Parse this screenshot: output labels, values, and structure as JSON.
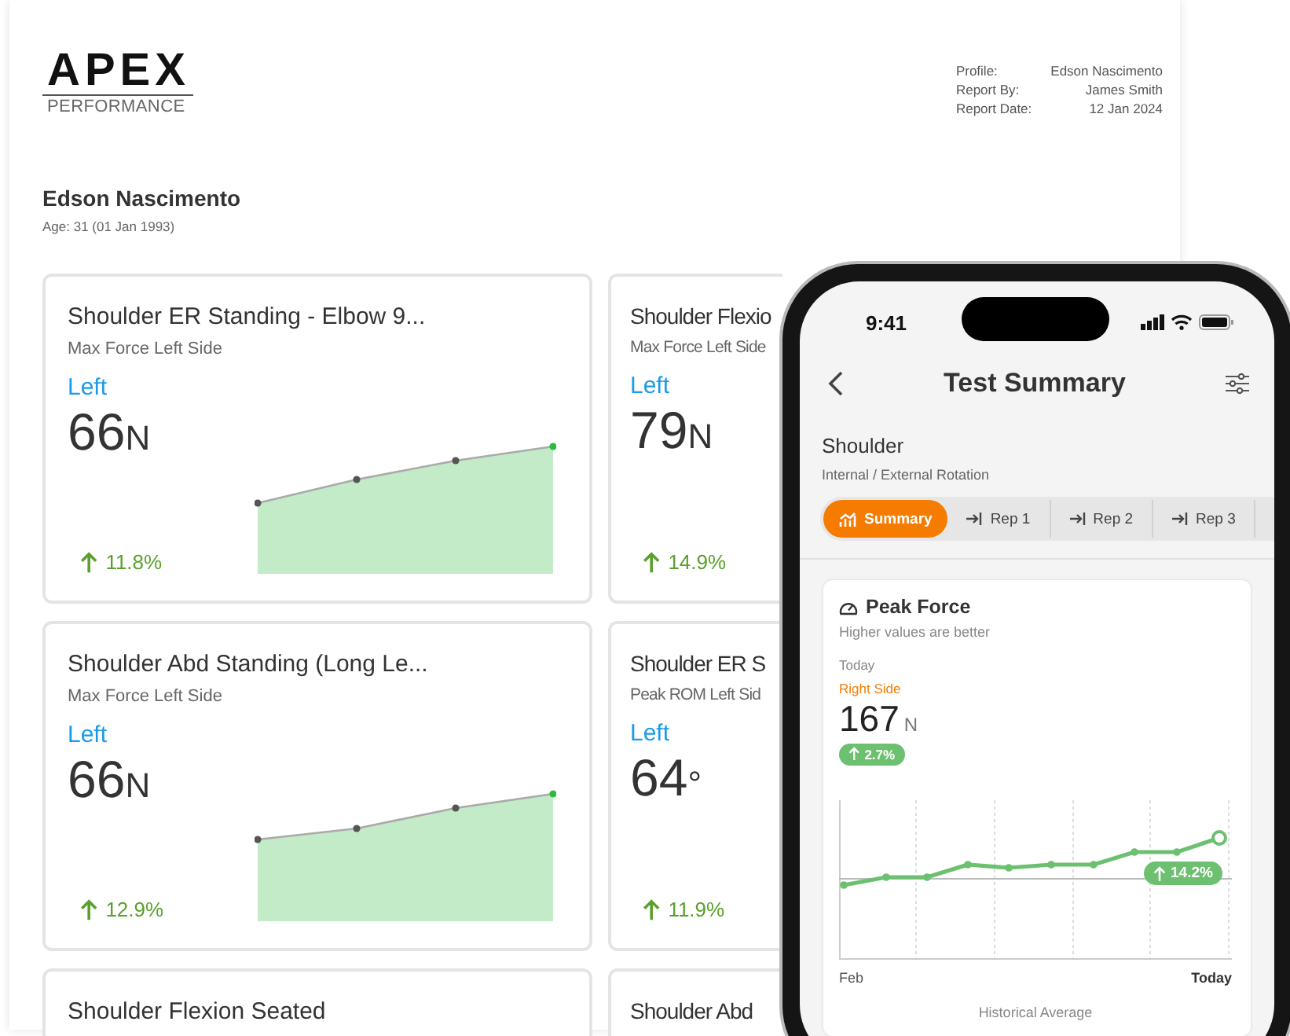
{
  "logo": {
    "name": "APEX",
    "tagline": "PERFORMANCE"
  },
  "meta": [
    {
      "label": "Profile:",
      "value": "Edson Nascimento"
    },
    {
      "label": "Report By:",
      "value": "James Smith"
    },
    {
      "label": "Report Date:",
      "value": "12 Jan 2024"
    }
  ],
  "athlete": {
    "name": "Edson Nascimento",
    "age": "Age: 31 (01 Jan 1993)"
  },
  "cards": [
    {
      "title": "Shoulder ER Standing - Elbow 9...",
      "subtitle": "Max Force Left Side",
      "side": "Left",
      "value": "66",
      "unit": "N",
      "change": "11.8%"
    },
    {
      "title": "Shoulder Flexio",
      "subtitle": "Max Force Left Side",
      "side": "Left",
      "value": "79",
      "unit": "N",
      "change": "14.9%"
    },
    {
      "title": "Shoulder Abd Standing (Long Le...",
      "subtitle": "Max Force Left Side",
      "side": "Left",
      "value": "66",
      "unit": "N",
      "change": "12.9%"
    },
    {
      "title": "Shoulder ER S",
      "subtitle": "Peak ROM Left Sid",
      "side": "Left",
      "value": "64",
      "unit": "°",
      "change": "11.9%"
    },
    {
      "title": "Shoulder Flexion Seated"
    },
    {
      "title": "Shoulder Abd"
    }
  ],
  "phone": {
    "time": "9:41",
    "title": "Test Summary",
    "section": "Shoulder",
    "subsection": "Internal / External Rotation",
    "tabs": [
      {
        "label": "Summary",
        "selected": true
      },
      {
        "label": "Rep 1",
        "selected": false
      },
      {
        "label": "Rep 2",
        "selected": false
      },
      {
        "label": "Rep 3",
        "selected": false
      }
    ],
    "metric": {
      "title": "Peak Force",
      "hint": "Higher values are better",
      "period": "Today",
      "side": "Right Side",
      "value": "167",
      "unit": "N",
      "change": "2.7%",
      "trend_change": "14.2%",
      "x_start": "Feb",
      "x_end": "Today",
      "legend": "Historical Average"
    }
  }
}
